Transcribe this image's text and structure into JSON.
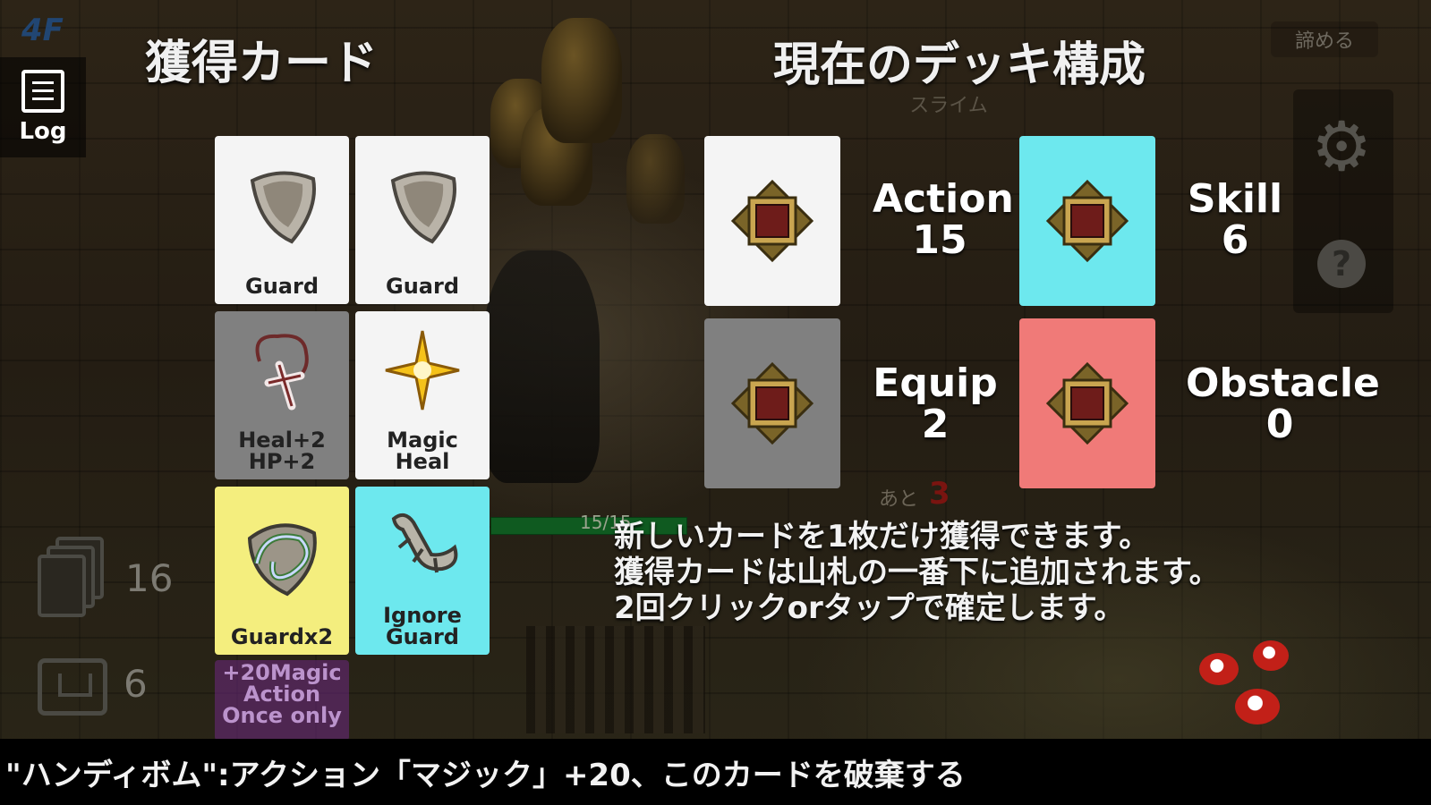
{
  "hud": {
    "floor": "4F",
    "log_label": "Log",
    "give_up": "諦める",
    "deck_count": "16",
    "discard_count": "6"
  },
  "scene": {
    "enemy_name": "スライム",
    "hp_text": "15/15",
    "remaining_label": "あと",
    "remaining_value": "3"
  },
  "acquire": {
    "title": "獲得カード",
    "cards": [
      {
        "label": "Guard",
        "color": "white",
        "icon": "shield-icon"
      },
      {
        "label": "Guard",
        "color": "white",
        "icon": "shield-icon"
      },
      {
        "label": "Heal+2\nHP+2",
        "color": "gray",
        "icon": "cross-amulet-icon"
      },
      {
        "label": "Magic\nHeal",
        "color": "white",
        "icon": "sparkle-star-icon"
      },
      {
        "label": "Guardx2",
        "color": "yellow",
        "icon": "swirl-shield-icon"
      },
      {
        "label": "Ignore\nGuard",
        "color": "cyan",
        "icon": "lizard-icon"
      },
      {
        "label": "+20Magic\nAction\nOnce only",
        "color": "purple",
        "icon": "bomb-icon"
      }
    ]
  },
  "deck": {
    "title": "現在のデッキ構成",
    "types": [
      {
        "name": "Action",
        "count": "15",
        "color": "#f4f4f4"
      },
      {
        "name": "Skill",
        "count": "6",
        "color": "#6de8ee"
      },
      {
        "name": "Equip",
        "count": "2",
        "color": "#808080"
      },
      {
        "name": "Obstacle",
        "count": "0",
        "color": "#f07a78"
      }
    ]
  },
  "info": {
    "lines": [
      "新しいカードを1枚だけ獲得できます。",
      "獲得カードは山札の一番下に追加されます。",
      "2回クリックorタップで確定します。"
    ]
  },
  "description": "\"ハンディボム\":アクション「マジック」+20、このカードを破棄する"
}
